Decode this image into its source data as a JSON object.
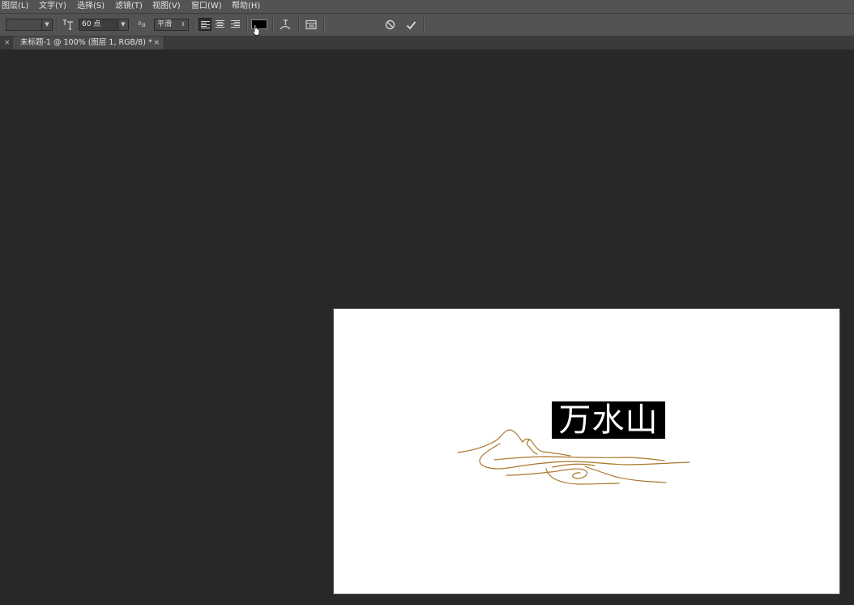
{
  "menu": [
    "图层(L)",
    "文字(Y)",
    "选择(S)",
    "滤镜(T)",
    "视图(V)",
    "窗口(W)",
    "帮助(H)"
  ],
  "options": {
    "font_family": "-",
    "font_size": "60 点",
    "antialias": "平滑",
    "text_color": "#000000"
  },
  "tab": {
    "title": "未标题-1 @ 100% (图层 1, RGB/8) *"
  },
  "canvas": {
    "text": "万水山"
  },
  "colors": {
    "workspace": "#282828",
    "panel": "#535353",
    "ornament": "#a9782a"
  },
  "icons": {
    "text-orientation": "text-orientation-icon",
    "font-size": "font-size-icon",
    "antialias": "antialias-icon",
    "align-left": "align-left-icon",
    "align-center": "align-center-icon",
    "align-right": "align-right-icon",
    "warp": "warp-text-icon",
    "panels": "character-panel-icon",
    "cancel": "cancel-icon",
    "commit": "checkmark-icon"
  }
}
